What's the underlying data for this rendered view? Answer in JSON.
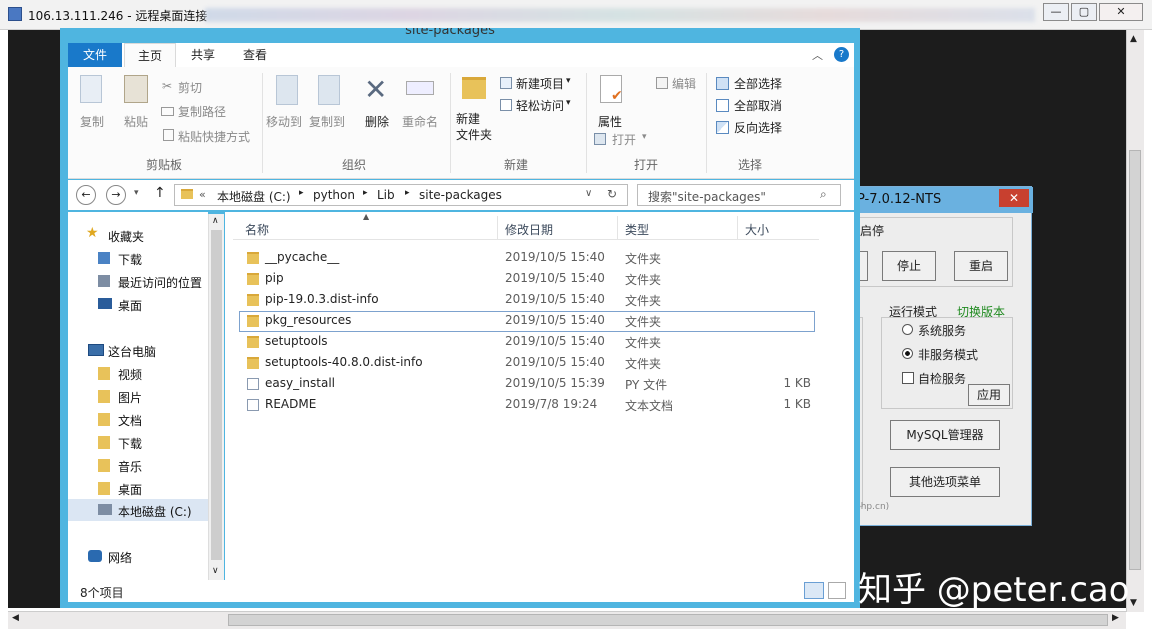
{
  "rdp": {
    "title": "106.13.111.246 - 远程桌面连接"
  },
  "explorer": {
    "title": "site-packages",
    "tabs": [
      "文件",
      "主页",
      "共享",
      "查看"
    ],
    "ribbon": {
      "clipboard": {
        "copy": "复制",
        "paste": "粘贴",
        "cut": "剪切",
        "copy_path": "复制路径",
        "paste_shortcut": "粘贴快捷方式",
        "group": "剪贴板"
      },
      "organize": {
        "move_to": "移动到",
        "copy_to": "复制到",
        "delete": "删除",
        "rename": "重命名",
        "group": "组织"
      },
      "new": {
        "new_folder": "新建\n文件夹",
        "new_item": "新建项目",
        "easy_access": "轻松访问",
        "group": "新建"
      },
      "open": {
        "properties": "属性",
        "open": "打开",
        "edit": "编辑",
        "group": "打开"
      },
      "select": {
        "select_all": "全部选择",
        "select_none": "全部取消",
        "invert": "反向选择",
        "group": "选择"
      }
    },
    "breadcrumb": [
      "本地磁盘 (C:)",
      "python",
      "Lib",
      "site-packages"
    ],
    "search_placeholder": "搜索\"site-packages\"",
    "nav": {
      "favorites": "收藏夹",
      "fav_items": [
        "下载",
        "最近访问的位置",
        "桌面"
      ],
      "this_pc": "这台电脑",
      "pc_items": [
        "视频",
        "图片",
        "文档",
        "下载",
        "音乐",
        "桌面",
        "本地磁盘 (C:)"
      ],
      "network": "网络"
    },
    "columns": {
      "name": "名称",
      "date": "修改日期",
      "type": "类型",
      "size": "大小"
    },
    "files": [
      {
        "name": "__pycache__",
        "date": "2019/10/5 15:40",
        "type": "文件夹",
        "size": ""
      },
      {
        "name": "pip",
        "date": "2019/10/5 15:40",
        "type": "文件夹",
        "size": ""
      },
      {
        "name": "pip-19.0.3.dist-info",
        "date": "2019/10/5 15:40",
        "type": "文件夹",
        "size": ""
      },
      {
        "name": "pkg_resources",
        "date": "2019/10/5 15:40",
        "type": "文件夹",
        "size": ""
      },
      {
        "name": "setuptools",
        "date": "2019/10/5 15:40",
        "type": "文件夹",
        "size": ""
      },
      {
        "name": "setuptools-40.8.0.dist-info",
        "date": "2019/10/5 15:40",
        "type": "文件夹",
        "size": ""
      },
      {
        "name": "easy_install",
        "date": "2019/10/5 15:39",
        "type": "PY 文件",
        "size": "1 KB"
      },
      {
        "name": "README",
        "date": "2019/7/8 19:24",
        "type": "文本文档",
        "size": "1 KB"
      }
    ],
    "status": "8个项目"
  },
  "php": {
    "title": "P-7.0.12-NTS",
    "start_stop": "启停",
    "stop": "停止",
    "restart": "重启",
    "run_mode": "运行模式",
    "switch_version": "切换版本",
    "sys_service": "系统服务",
    "non_service": "非服务模式",
    "self_check": "自检服务",
    "apply": "应用",
    "mysql": "MySQL管理器",
    "other": "其他选项菜单",
    "footer": "php.cn)"
  },
  "watermark": "知乎 @peter.cao",
  "colors": {
    "accent": "#4fb5e0",
    "file_tab": "#1979ca",
    "close": "#c8402f"
  }
}
